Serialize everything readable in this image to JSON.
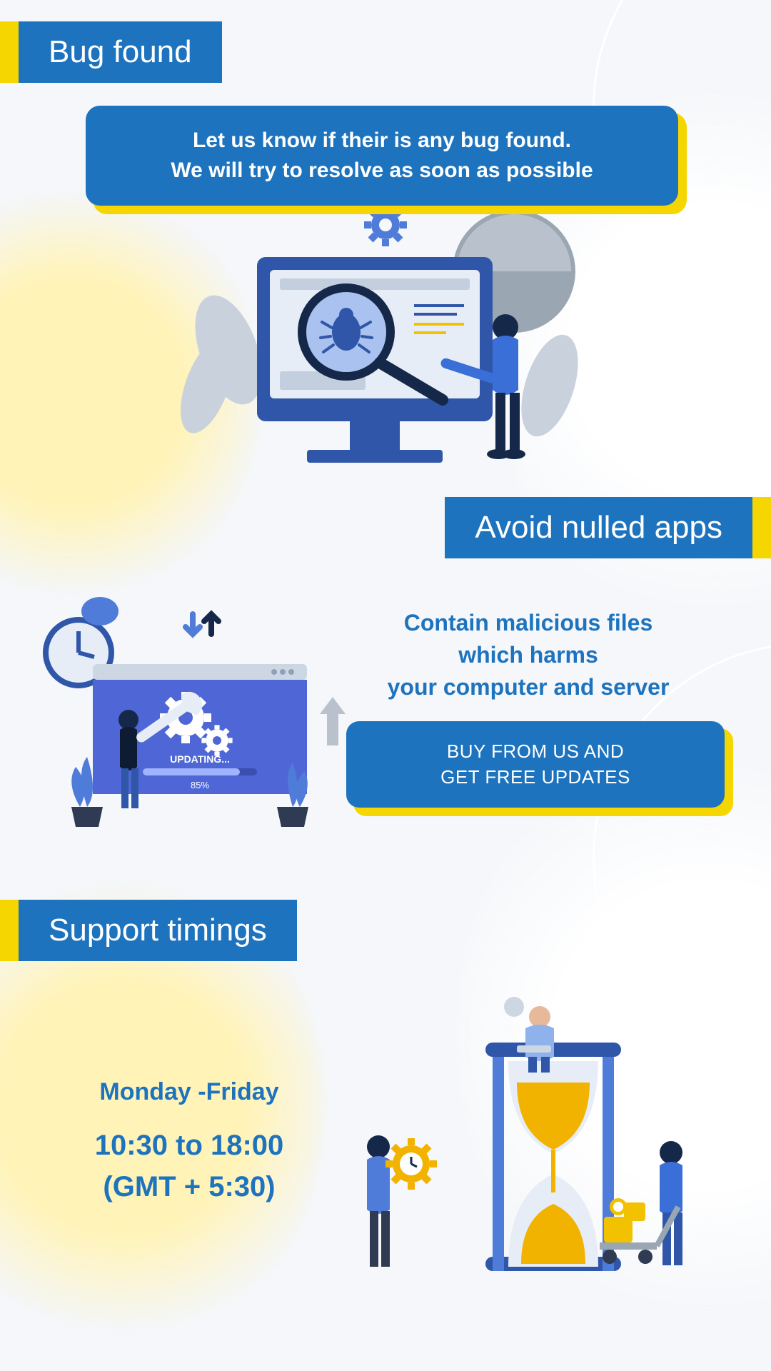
{
  "sections": {
    "bug": {
      "heading": "Bug found",
      "callout_line1": "Let us know if their is any bug found.",
      "callout_line2": "We will try to resolve as soon as possible"
    },
    "nulled": {
      "heading": "Avoid nulled apps",
      "text_line1": "Contain malicious files",
      "text_line2": "which harms",
      "text_line3": "your computer and server",
      "cta_line1": "BUY FROM US AND",
      "cta_line2": "GET FREE UPDATES",
      "illus_updating_label": "UPDATING...",
      "illus_updating_percent": "85%"
    },
    "timings": {
      "heading": "Support timings",
      "days": "Monday -Friday",
      "hours": "10:30 to 18:00",
      "tz": "(GMT + 5:30)"
    }
  },
  "colors": {
    "primary": "#1d73be",
    "accent": "#f5d600"
  }
}
